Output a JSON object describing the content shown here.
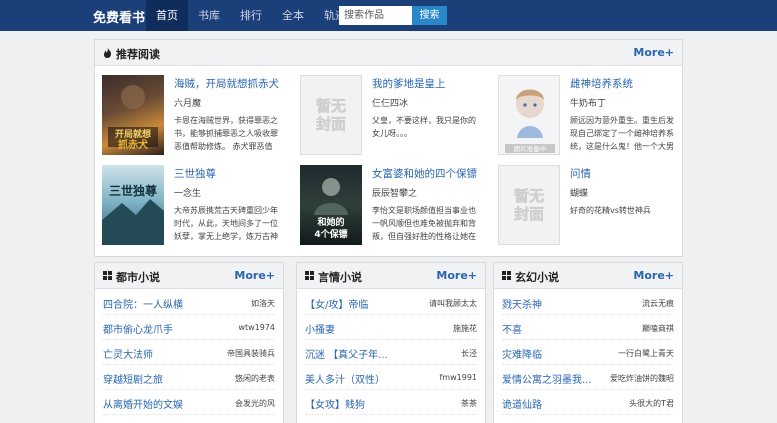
{
  "nav": {
    "logo": "免费看书",
    "items": [
      "首页",
      "书库",
      "排行",
      "全本",
      "轨迹"
    ],
    "search_placeholder": "搜索作品",
    "search_button": "搜索"
  },
  "recommend": {
    "title": "推荐阅读",
    "more": "More+",
    "books": [
      {
        "title": "海贼，开局就想抓赤犬",
        "author": "六月魔",
        "desc": "卡恩在海贼世界，获得罪恶之书，能够抓捕罪恶之人吸收罪恶值帮助修炼。 赤犬罪恶值",
        "cover_text": "开局就想抓赤犬"
      },
      {
        "title": "我的爹地是皇上",
        "author": "仨仨四冰",
        "desc": "父皇，不要这样，我只是你的女儿呀。。。",
        "cover_text": "暂无封面"
      },
      {
        "title": "雌神培养系统",
        "author": "牛奶布丁",
        "desc": "顾远因为意外重生。重生后发现自己绑定了一个雌神培养系统，这是什么鬼！他一个大男",
        "cover_text": "图片准备中"
      },
      {
        "title": "三世独尊",
        "author": "一念生",
        "desc": "大帝苏辰携荒古天碑重回少年时代，从此，天地间多了一位妖孽，掌无上绝学，炼万古神",
        "cover_text": "三世独尊"
      },
      {
        "title": "女富婆和她的四个保镖",
        "author": "辰辰智攀之",
        "desc": "李怡文是职场颜值担当事业也一帆风顺但也难免被抛弃和背叛，但自强好胜的性格让她在",
        "cover_text": "和她的4个保镖"
      },
      {
        "title": "问情",
        "author": "蝴蝶",
        "desc": "好奇的花精vs转世神兵",
        "cover_text": "暂无封面"
      }
    ]
  },
  "lists": [
    {
      "title": "都市小说",
      "more": "More+",
      "rows": [
        {
          "title": "四合院：一人纵横",
          "author": "如洛天"
        },
        {
          "title": "都市偷心龙爪手",
          "author": "wtw1974"
        },
        {
          "title": "亡灵大法师",
          "author": "帝国具装骑兵"
        },
        {
          "title": "穿越短剧之旅",
          "author": "悠闲的老表"
        },
        {
          "title": "从离婚开始的文娱",
          "author": "会发光的风"
        }
      ]
    },
    {
      "title": "言情小说",
      "more": "More+",
      "rows": [
        {
          "title": "【女/攻】帝临",
          "author": "请叫我顾太太"
        },
        {
          "title": "小搔妻",
          "author": "施施花"
        },
        {
          "title": "沉迷 【真父子年...",
          "author": "长泾"
        },
        {
          "title": "美人多汁（双性）",
          "author": "fmw1991"
        },
        {
          "title": "【女攻】贱狗",
          "author": "茶茶"
        }
      ]
    },
    {
      "title": "玄幻小说",
      "more": "More+",
      "rows": [
        {
          "title": "戮天杀神",
          "author": "流云无痕"
        },
        {
          "title": "不喜",
          "author": "巅嗑商祺"
        },
        {
          "title": "灾难降临",
          "author": "一行白鹭上青天"
        },
        {
          "title": "爱情公寓之羽墨我...",
          "author": "爱吃炸油饼的魏昭"
        },
        {
          "title": "诡道仙路",
          "author": "头很大的T君"
        }
      ]
    }
  ]
}
